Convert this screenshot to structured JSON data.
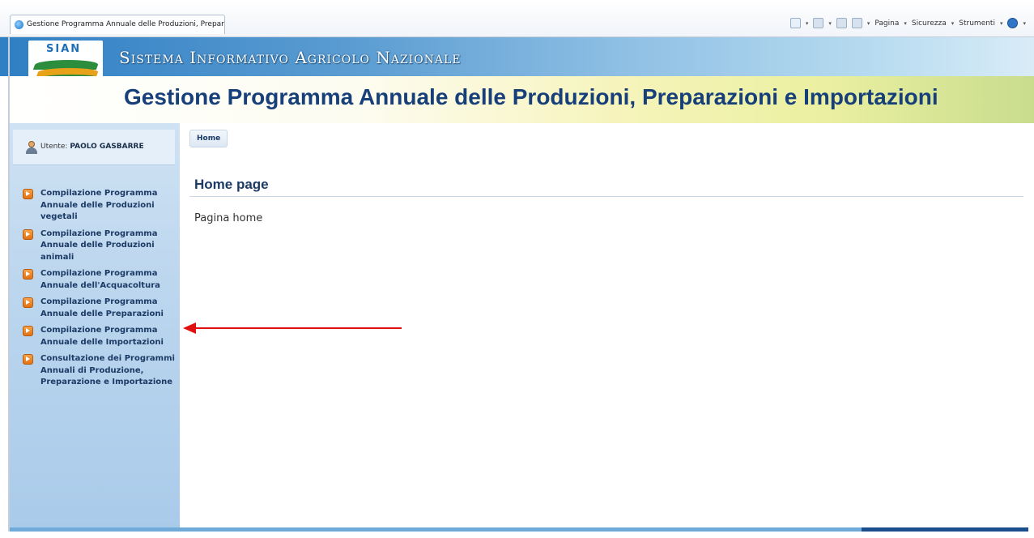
{
  "browser": {
    "tab_title": "Gestione Programma Annuale delle Produzioni, Prepar...",
    "toolbar": {
      "pagina": "Pagina",
      "sicurezza": "Sicurezza",
      "strumenti": "Strumenti",
      "caret": "▾"
    }
  },
  "header": {
    "logo_text": "SIAN",
    "system_name": "Sistema Informativo Agricolo Nazionale",
    "app_title": "Gestione Programma Annuale delle Produzioni, Preparazioni e Importazioni"
  },
  "sidebar": {
    "user_label": "Utente:",
    "user_name": "PAOLO GASBARRE",
    "menu": [
      {
        "label": "Compilazione Programma Annuale delle Produzioni vegetali"
      },
      {
        "label": "Compilazione Programma Annuale delle Produzioni animali"
      },
      {
        "label": "Compilazione Programma Annuale dell'Acquacoltura"
      },
      {
        "label": "Compilazione Programma Annuale delle Preparazioni"
      },
      {
        "label": "Compilazione Programma Annuale delle Importazioni"
      },
      {
        "label": "Consultazione dei Programmi Annuali di Produzione, Preparazione e Importazione"
      }
    ]
  },
  "main": {
    "breadcrumb": "Home",
    "page_title": "Home page",
    "page_text": "Pagina home"
  },
  "colors": {
    "accent": "#1c3a66",
    "arrow": "#e01010",
    "menu_icon": "#f08a2a"
  }
}
